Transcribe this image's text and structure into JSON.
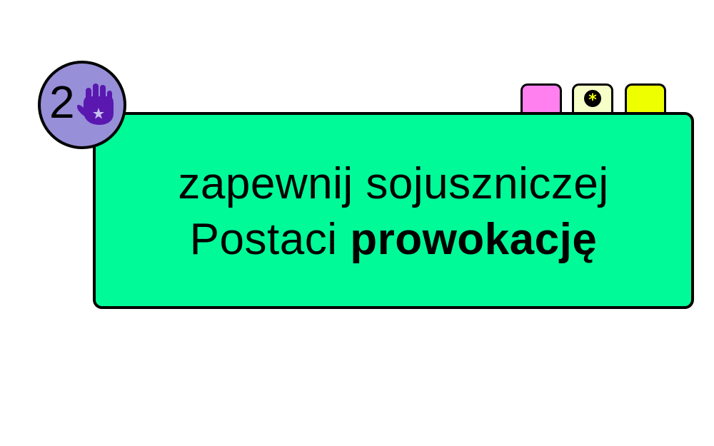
{
  "card": {
    "line1": "zapewnij sojuszniczej",
    "line2_regular": "Postaci ",
    "line2_bold": "prowokację",
    "background_color": "#00fa98"
  },
  "badge": {
    "number": "2",
    "icon": "hand-icon",
    "background_color": "#978fd8",
    "icon_color": "#5a18b0"
  },
  "tabs": [
    {
      "name": "pink-tab",
      "color": "#ff80ee"
    },
    {
      "name": "cream-tab",
      "color": "#f6ffc8",
      "icon": "asterisk-icon"
    },
    {
      "name": "yellow-tab",
      "color": "#eeff00"
    }
  ]
}
